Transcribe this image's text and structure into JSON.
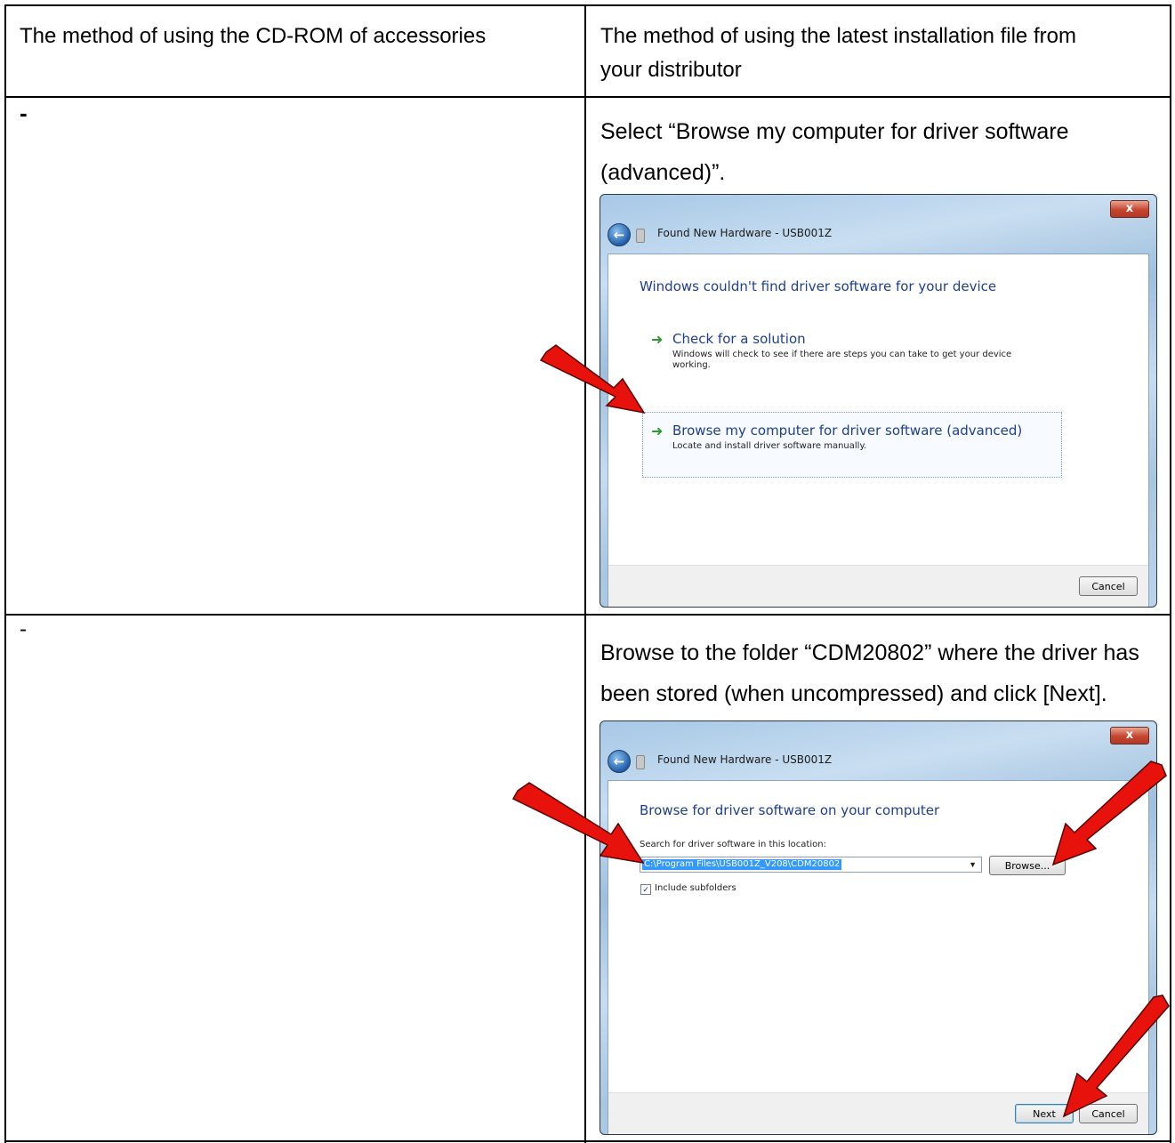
{
  "table": {
    "header": {
      "left": "The method of using the CD-ROM of accessories",
      "right_line1": "The method of using the latest installation file from",
      "right_line2": "your distributor"
    },
    "row1": {
      "left": "-",
      "right_line1": "Select “Browse my computer for driver software",
      "right_line2": "(advanced)”."
    },
    "row2": {
      "left": "-",
      "right_line1": "Browse to the folder “CDM20802” where the driver has",
      "right_line2": "been stored (when uncompressed) and click [Next]."
    }
  },
  "dialog1": {
    "close_label": "x",
    "title": "Found New Hardware - USB001Z",
    "heading": "Windows couldn't find driver software for your device",
    "option1_title": "Check for a solution",
    "option1_desc_line1": "Windows will check to see if there are steps you can take to get your device",
    "option1_desc_line2": "working.",
    "option2_title": "Browse my computer for driver software (advanced)",
    "option2_desc": "Locate and install driver software manually.",
    "cancel_label": "Cancel"
  },
  "dialog2": {
    "close_label": "x",
    "title": "Found New Hardware - USB001Z",
    "heading": "Browse for driver software on your computer",
    "search_label": "Search for driver software in this location:",
    "path_value": "C:\\Program Files\\USB001Z_V208\\CDM20802",
    "browse_label": "Browse...",
    "include_subfolders_label": "Include subfolders",
    "include_subfolders_checked": true,
    "next_label": "Next",
    "cancel_label": "Cancel"
  },
  "colors": {
    "annotation_arrow": "#e8120c",
    "dialog_heading": "#1e3f8f",
    "option_arrow": "#2e9a2e",
    "selection": "#3399ff"
  }
}
